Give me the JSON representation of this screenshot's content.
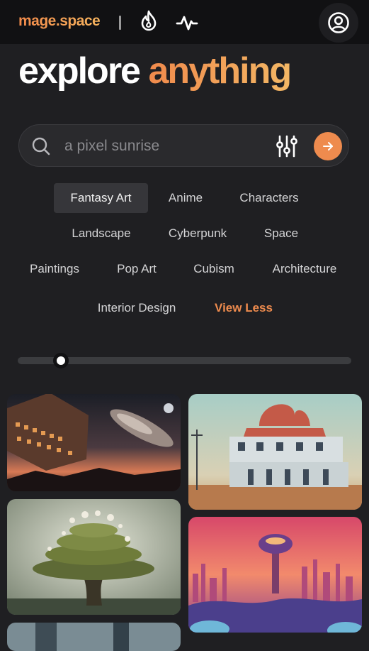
{
  "header": {
    "logo_text": "mage.space",
    "icons": [
      "fire-icon",
      "pulse-icon",
      "user-circle-icon"
    ]
  },
  "hero": {
    "title_word_1": "explore",
    "title_word_2": "anything"
  },
  "search": {
    "placeholder": "a pixel sunrise",
    "value": ""
  },
  "categories": [
    "Fantasy Art",
    "Anime",
    "Characters",
    "Landscape",
    "Cyberpunk",
    "Space",
    "Paintings",
    "Pop Art",
    "Cubism",
    "Architecture",
    "Interior Design"
  ],
  "selected_category": "Fantasy Art",
  "view_less_label": "View Less",
  "slider": {
    "value_fraction": 0.13
  },
  "gallery": [
    "spaceships over desert at dusk",
    "retro building on prairie",
    "floating mushroom island tree",
    "retro-futuristic city on pink planet"
  ],
  "colors": {
    "accent": "#ee8b4e",
    "background": "#1f1f22",
    "topbar": "#111113"
  }
}
